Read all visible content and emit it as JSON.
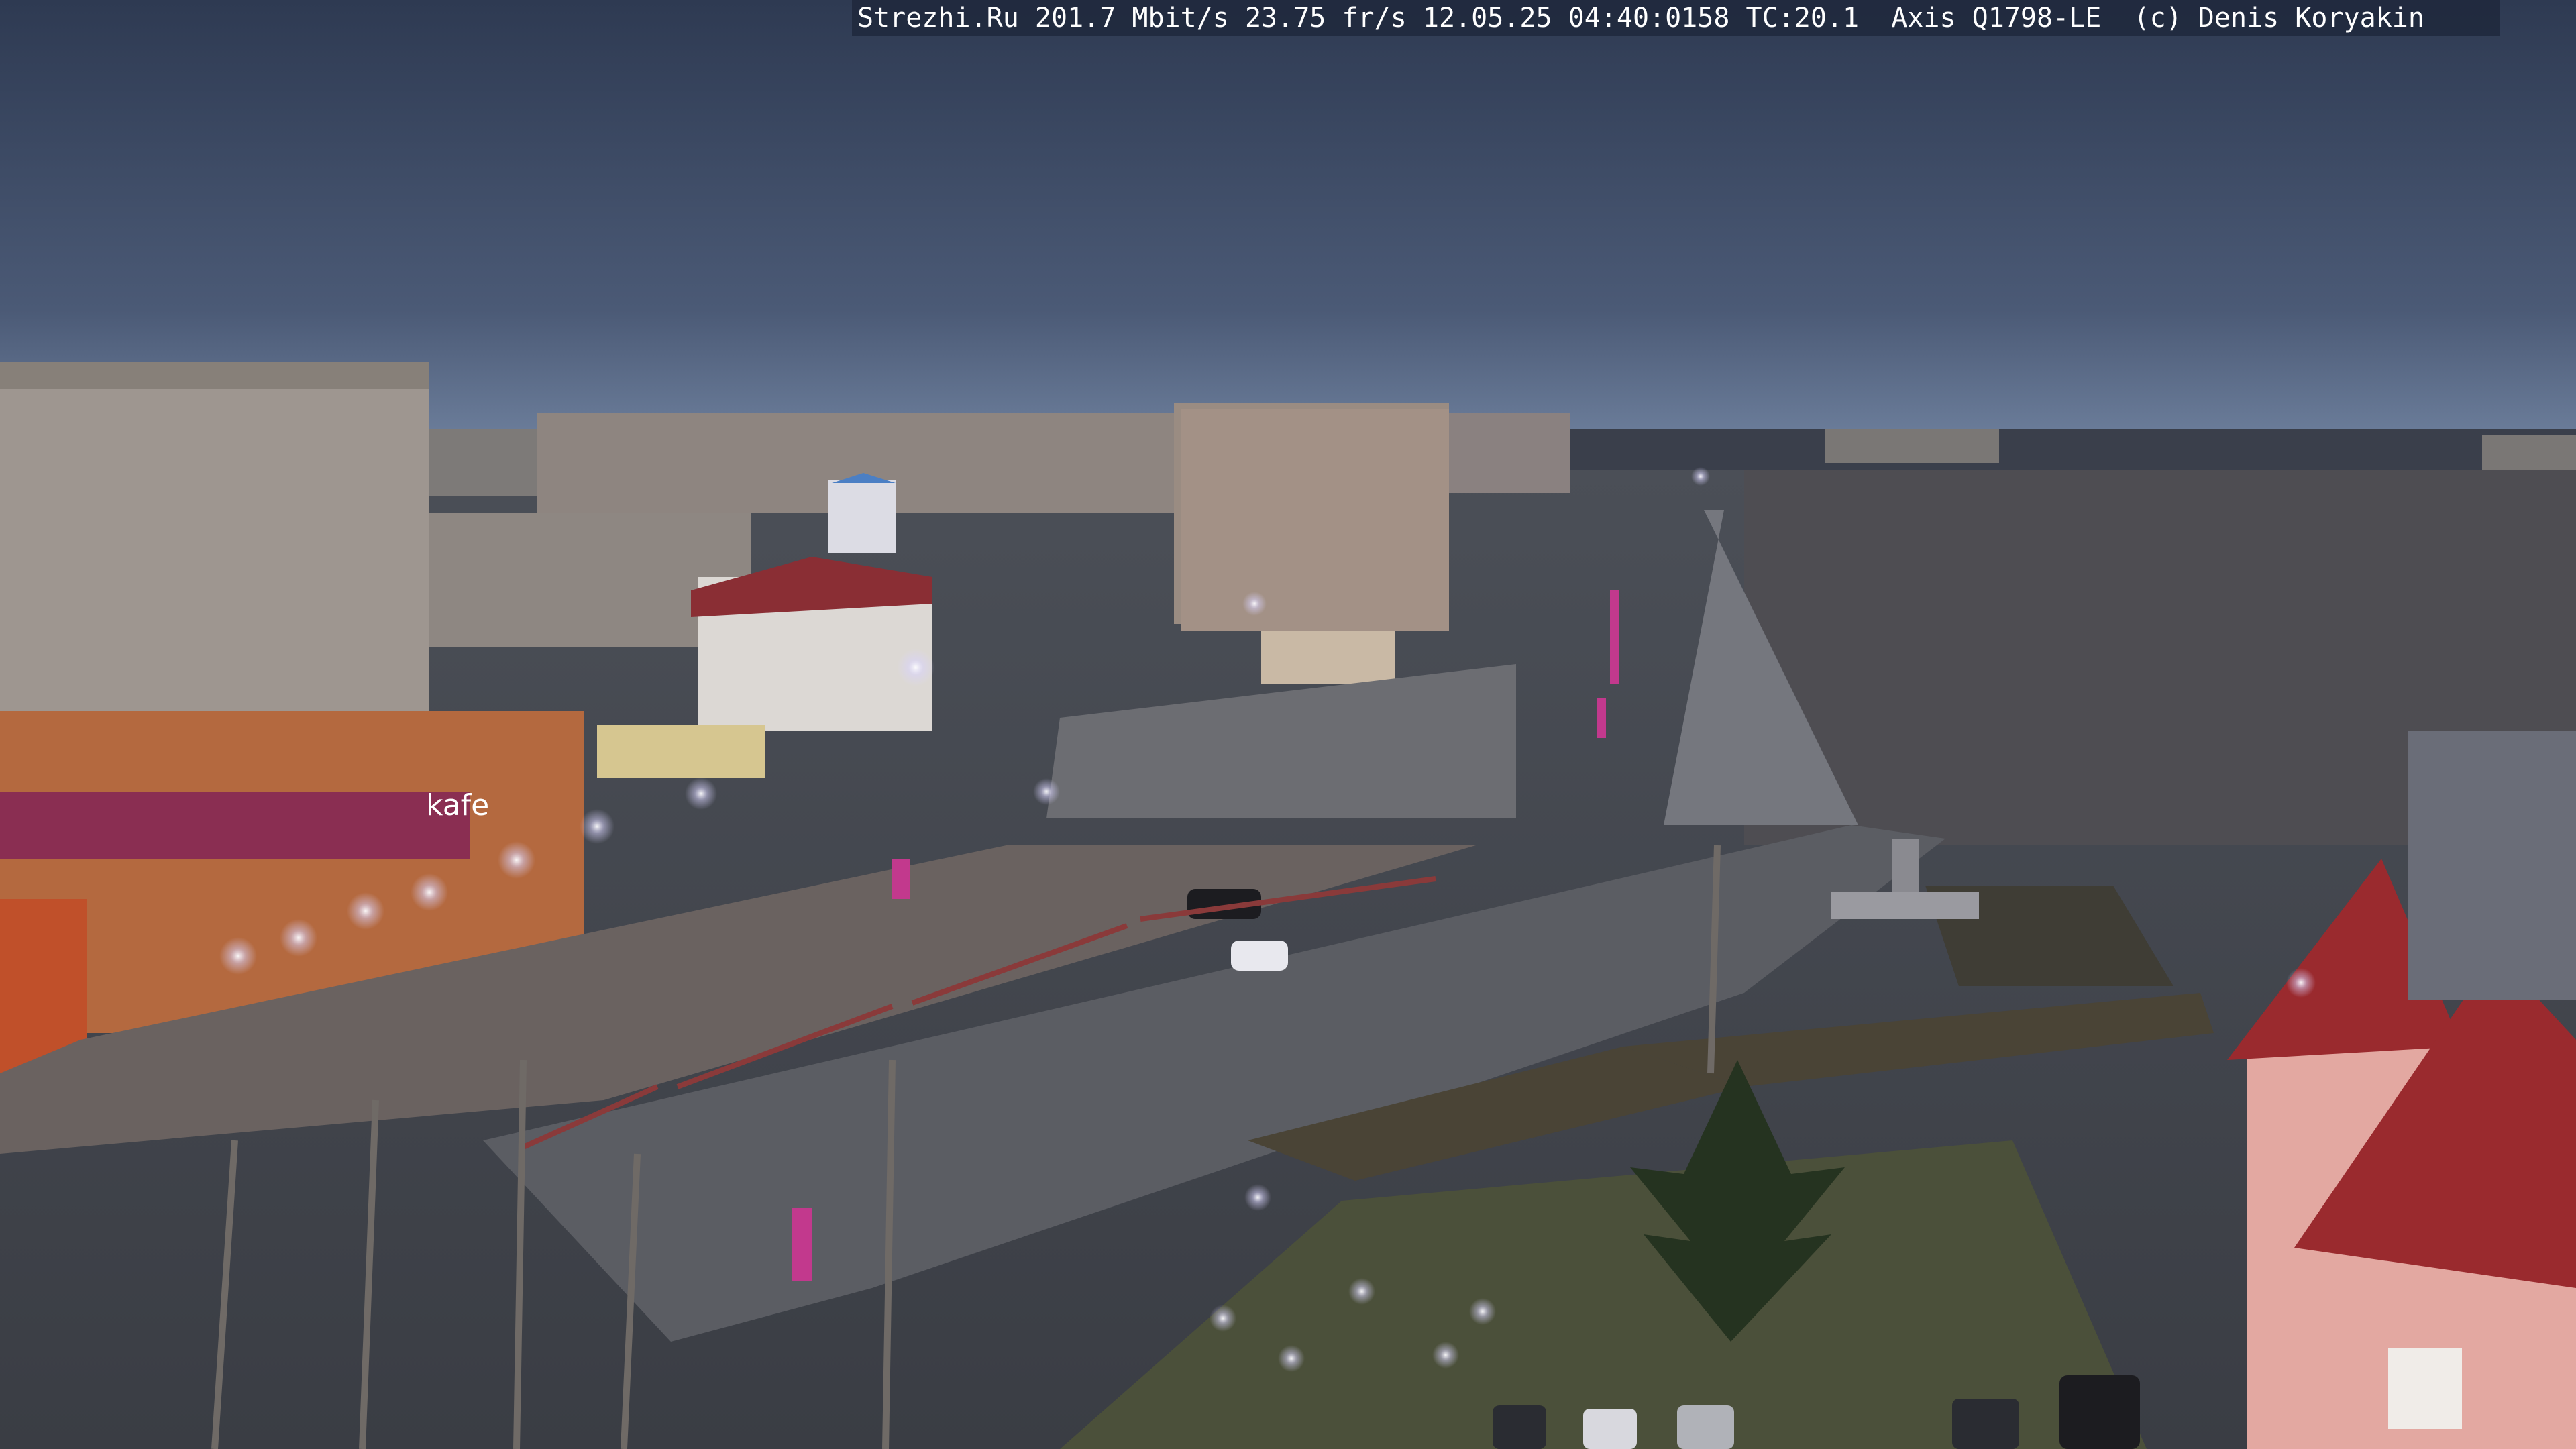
{
  "overlay": {
    "text": "Strezhi.Ru 201.7 Mbit/s 23.75 fr/s 12.05.25 04:40:0158 TC:20.1  Axis Q1798-LE  (c) Denis Koryakin"
  },
  "signs": {
    "kafe": "kafe"
  },
  "colors": {
    "sky_top": "#2e3a52",
    "sky_bottom": "#6d7f9c",
    "road": "#55585f",
    "grass": "#3d4a2c",
    "accent_pink": "#c2398d",
    "street_light": "#f4f2ff"
  }
}
